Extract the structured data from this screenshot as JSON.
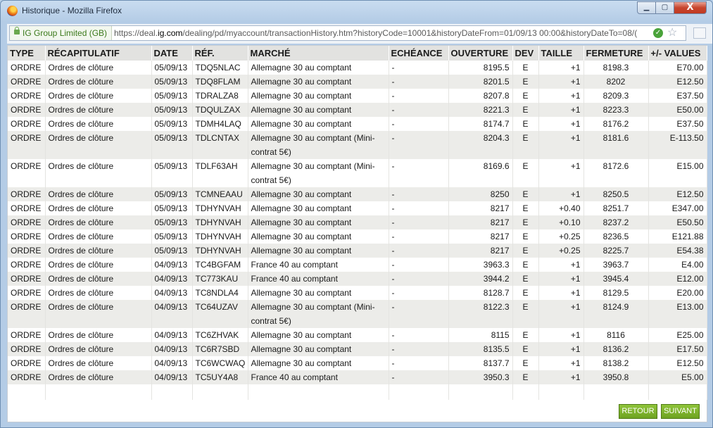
{
  "window": {
    "title": "Historique - Mozilla Firefox",
    "min_label": "▁",
    "max_label": "▢",
    "close_label": "X"
  },
  "urlbar": {
    "site_identity": "IG Group Limited (GB)",
    "url_prefix": "https://deal.",
    "url_domain": "ig.com",
    "url_rest": "/dealing/pd/myaccount/transactionHistory.htm?historyCode=10001&historyDateFrom=01/09/13 00:00&historyDateTo=08/("
  },
  "table": {
    "headers": [
      "TYPE",
      "RÉCAPITULATIF",
      "DATE",
      "RÉF.",
      "MARCHÉ",
      "ECHÉANCE",
      "OUVERTURE",
      "DEV",
      "TAILLE",
      "FERMETURE",
      "+/- VALUES"
    ],
    "rows": [
      [
        "ORDRE",
        "Ordres de clôture",
        "05/09/13",
        "TDQ5NLAC",
        "Allemagne 30 au comptant",
        "-",
        "8195.5",
        "E",
        "+1",
        "8198.3",
        "E70.00"
      ],
      [
        "ORDRE",
        "Ordres de clôture",
        "05/09/13",
        "TDQ8FLAM",
        "Allemagne 30 au comptant",
        "-",
        "8201.5",
        "E",
        "+1",
        "8202",
        "E12.50"
      ],
      [
        "ORDRE",
        "Ordres de clôture",
        "05/09/13",
        "TDRALZA8",
        "Allemagne 30 au comptant",
        "-",
        "8207.8",
        "E",
        "+1",
        "8209.3",
        "E37.50"
      ],
      [
        "ORDRE",
        "Ordres de clôture",
        "05/09/13",
        "TDQULZAX",
        "Allemagne 30 au comptant",
        "-",
        "8221.3",
        "E",
        "+1",
        "8223.3",
        "E50.00"
      ],
      [
        "ORDRE",
        "Ordres de clôture",
        "05/09/13",
        "TDMH4LAQ",
        "Allemagne 30 au comptant",
        "-",
        "8174.7",
        "E",
        "+1",
        "8176.2",
        "E37.50"
      ],
      [
        "ORDRE",
        "Ordres de clôture",
        "05/09/13",
        "TDLCNTAX",
        "Allemagne 30 au comptant (Mini-contrat 5€)",
        "-",
        "8204.3",
        "E",
        "+1",
        "8181.6",
        "E-113.50"
      ],
      [
        "ORDRE",
        "Ordres de clôture",
        "05/09/13",
        "TDLF63AH",
        "Allemagne 30 au comptant (Mini-contrat 5€)",
        "-",
        "8169.6",
        "E",
        "+1",
        "8172.6",
        "E15.00"
      ],
      [
        "ORDRE",
        "Ordres de clôture",
        "05/09/13",
        "TCMNEAAU",
        "Allemagne 30 au comptant",
        "-",
        "8250",
        "E",
        "+1",
        "8250.5",
        "E12.50"
      ],
      [
        "ORDRE",
        "Ordres de clôture",
        "05/09/13",
        "TDHYNVAH",
        "Allemagne 30 au comptant",
        "-",
        "8217",
        "E",
        "+0.40",
        "8251.7",
        "E347.00"
      ],
      [
        "ORDRE",
        "Ordres de clôture",
        "05/09/13",
        "TDHYNVAH",
        "Allemagne 30 au comptant",
        "-",
        "8217",
        "E",
        "+0.10",
        "8237.2",
        "E50.50"
      ],
      [
        "ORDRE",
        "Ordres de clôture",
        "05/09/13",
        "TDHYNVAH",
        "Allemagne 30 au comptant",
        "-",
        "8217",
        "E",
        "+0.25",
        "8236.5",
        "E121.88"
      ],
      [
        "ORDRE",
        "Ordres de clôture",
        "05/09/13",
        "TDHYNVAH",
        "Allemagne 30 au comptant",
        "-",
        "8217",
        "E",
        "+0.25",
        "8225.7",
        "E54.38"
      ],
      [
        "ORDRE",
        "Ordres de clôture",
        "04/09/13",
        "TC4BGFAM",
        "France 40 au comptant",
        "-",
        "3963.3",
        "E",
        "+1",
        "3963.7",
        "E4.00"
      ],
      [
        "ORDRE",
        "Ordres de clôture",
        "04/09/13",
        "TC773KAU",
        "France 40 au comptant",
        "-",
        "3944.2",
        "E",
        "+1",
        "3945.4",
        "E12.00"
      ],
      [
        "ORDRE",
        "Ordres de clôture",
        "04/09/13",
        "TC8NDLA4",
        "Allemagne 30 au comptant",
        "-",
        "8128.7",
        "E",
        "+1",
        "8129.5",
        "E20.00"
      ],
      [
        "ORDRE",
        "Ordres de clôture",
        "04/09/13",
        "TC64UZAV",
        "Allemagne 30 au comptant (Mini-contrat 5€)",
        "-",
        "8122.3",
        "E",
        "+1",
        "8124.9",
        "E13.00"
      ],
      [
        "ORDRE",
        "Ordres de clôture",
        "04/09/13",
        "TC6ZHVAK",
        "Allemagne 30 au comptant",
        "-",
        "8115",
        "E",
        "+1",
        "8116",
        "E25.00"
      ],
      [
        "ORDRE",
        "Ordres de clôture",
        "04/09/13",
        "TC6R7SBD",
        "Allemagne 30 au comptant",
        "-",
        "8135.5",
        "E",
        "+1",
        "8136.2",
        "E17.50"
      ],
      [
        "ORDRE",
        "Ordres de clôture",
        "04/09/13",
        "TC6WCWAQ",
        "Allemagne 30 au comptant",
        "-",
        "8137.7",
        "E",
        "+1",
        "8138.2",
        "E12.50"
      ],
      [
        "ORDRE",
        "Ordres de clôture",
        "04/09/13",
        "TC5UY4A8",
        "France 40 au comptant",
        "-",
        "3950.3",
        "E",
        "+1",
        "3950.8",
        "E5.00"
      ]
    ]
  },
  "buttons": {
    "retour": "RETOUR",
    "suivant": "SUIVANT"
  },
  "icons": {
    "app": "firefox-icon",
    "lock": "lock-icon",
    "verified": "check-icon",
    "bookmark": "star-icon"
  },
  "colors": {
    "accent_green": "#6ea321",
    "header_bg": "#e2e2e0",
    "alt_row_bg": "#ecece9"
  }
}
